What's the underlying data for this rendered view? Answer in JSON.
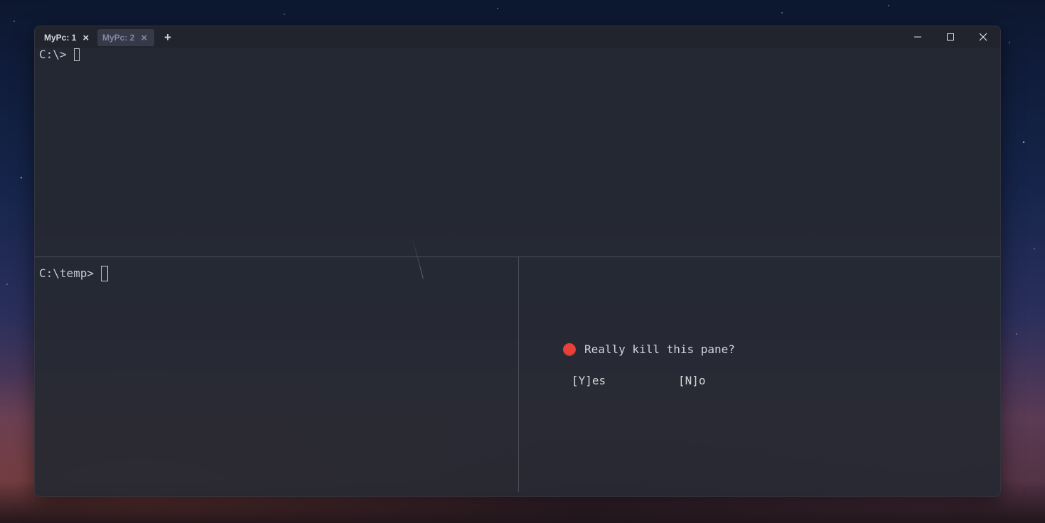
{
  "tabs": [
    {
      "label": "MyPc: 1",
      "active": true
    },
    {
      "label": "MyPc: 2",
      "active": false
    }
  ],
  "new_tab_label": "+",
  "window_controls": {
    "minimize": "minimize-icon",
    "maximize": "maximize-icon",
    "close": "close-icon"
  },
  "panes": {
    "top": {
      "prompt": "C:\\>"
    },
    "bottom_left": {
      "prompt": "C:\\temp>"
    },
    "bottom_right": {
      "dialog": {
        "message": "Really kill this pane?",
        "icon": "stop-sign-icon",
        "icon_color": "#e8413a",
        "yes_label": "[Y]es",
        "no_label": "[N]o"
      }
    }
  },
  "colors": {
    "terminal_bg": "#262931",
    "terminal_fg": "#c9ccd2",
    "inactive_tab_bg": "#363a48",
    "inactive_tab_fg": "#8389a4"
  }
}
